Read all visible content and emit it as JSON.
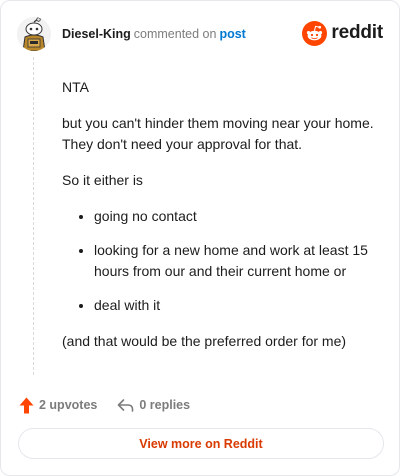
{
  "header": {
    "author": "Diesel-King",
    "action": "commented on",
    "post_link": "post",
    "brand": "reddit"
  },
  "comment": {
    "p1": "NTA",
    "p2": "but you can't hinder them moving near your home. They don't need your approval for that.",
    "p3": "So it either is",
    "bullets": [
      "going no contact",
      "looking for a new home and work at least 15 hours from our and their current home or",
      "deal with it"
    ],
    "p4": "(and that would be the preferred order for me)"
  },
  "footer": {
    "upvotes": "2 upvotes",
    "replies": "0 replies",
    "view_more": "View more on Reddit"
  },
  "colors": {
    "brand_orange": "#ff4500",
    "link_blue": "#0079d3",
    "muted_gray": "#7c7c7c",
    "button_text": "#d93a00"
  },
  "icons": {
    "avatar": "snoo-avatar",
    "brand": "reddit-logo-icon",
    "upvote": "upvote-arrow-icon",
    "reply": "reply-arrow-icon"
  }
}
